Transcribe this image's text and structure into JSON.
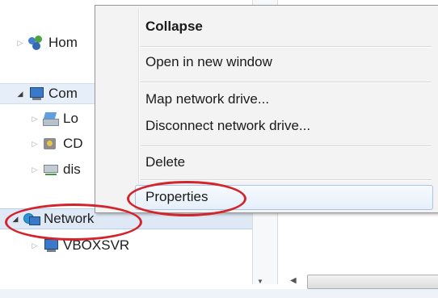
{
  "tree": {
    "items": [
      {
        "label": "Hom",
        "icon": "homegroup-icon",
        "expand": "▷"
      },
      {
        "label": "Com",
        "icon": "computer-icon",
        "expand": "◢"
      },
      {
        "label": "Lo",
        "icon": "local-disk-icon",
        "expand": "▷"
      },
      {
        "label": "CD",
        "icon": "cd-drive-icon",
        "expand": "▷"
      },
      {
        "label": "dis",
        "icon": "network-drive-icon",
        "expand": "▷"
      },
      {
        "label": "Network",
        "icon": "network-icon",
        "expand": "◢"
      },
      {
        "label": "VBOXSVR",
        "icon": "computer-icon",
        "expand": "▷"
      }
    ]
  },
  "context_menu": {
    "items": [
      {
        "label": "Collapse",
        "default": true
      },
      {
        "label": "Open in new window"
      },
      {
        "label": "Map network drive..."
      },
      {
        "label": "Disconnect network drive..."
      },
      {
        "label": "Delete"
      },
      {
        "label": "Properties",
        "highlighted": true
      }
    ]
  },
  "scrollbar": {
    "down_arrow": "▼",
    "left_arrow": "◀"
  },
  "colors": {
    "annotation": "#d3242c",
    "selection": "#e6eff9",
    "menu_background": "#f3f3f3",
    "highlight_border": "#a9c4e6"
  }
}
